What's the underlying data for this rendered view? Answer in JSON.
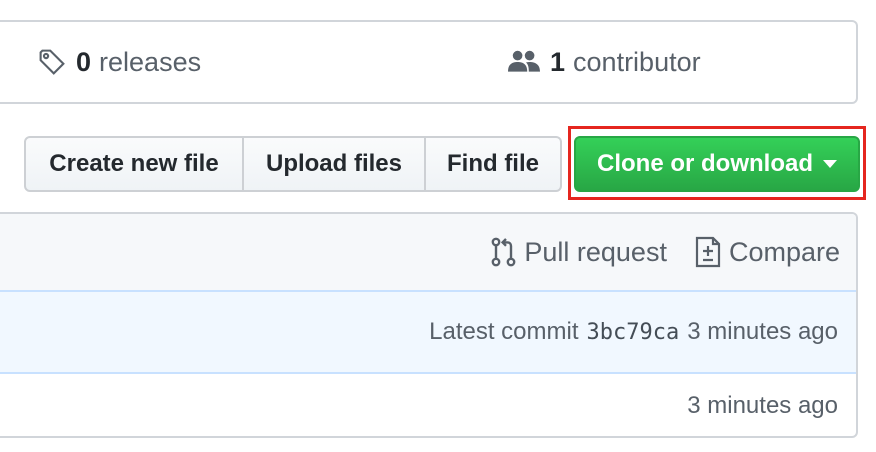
{
  "stats": {
    "releases": {
      "count": "0",
      "label": "releases",
      "icon": "tag-icon"
    },
    "contributors": {
      "count": "1",
      "label": "contributor",
      "icon": "people-icon"
    }
  },
  "toolbar": {
    "create_new_file": "Create new file",
    "upload_files": "Upload files",
    "find_file": "Find file",
    "clone_or_download": "Clone or download"
  },
  "branch_bar": {
    "pull_request": "Pull request",
    "compare": "Compare"
  },
  "commit": {
    "prefix": "Latest commit",
    "sha": "3bc79ca",
    "time": "3 minutes ago"
  },
  "file_row": {
    "time": "3 minutes ago"
  },
  "colors": {
    "clone_button": "#28a745",
    "highlight": "#e5261f",
    "commit_bg": "#f1f8ff"
  }
}
